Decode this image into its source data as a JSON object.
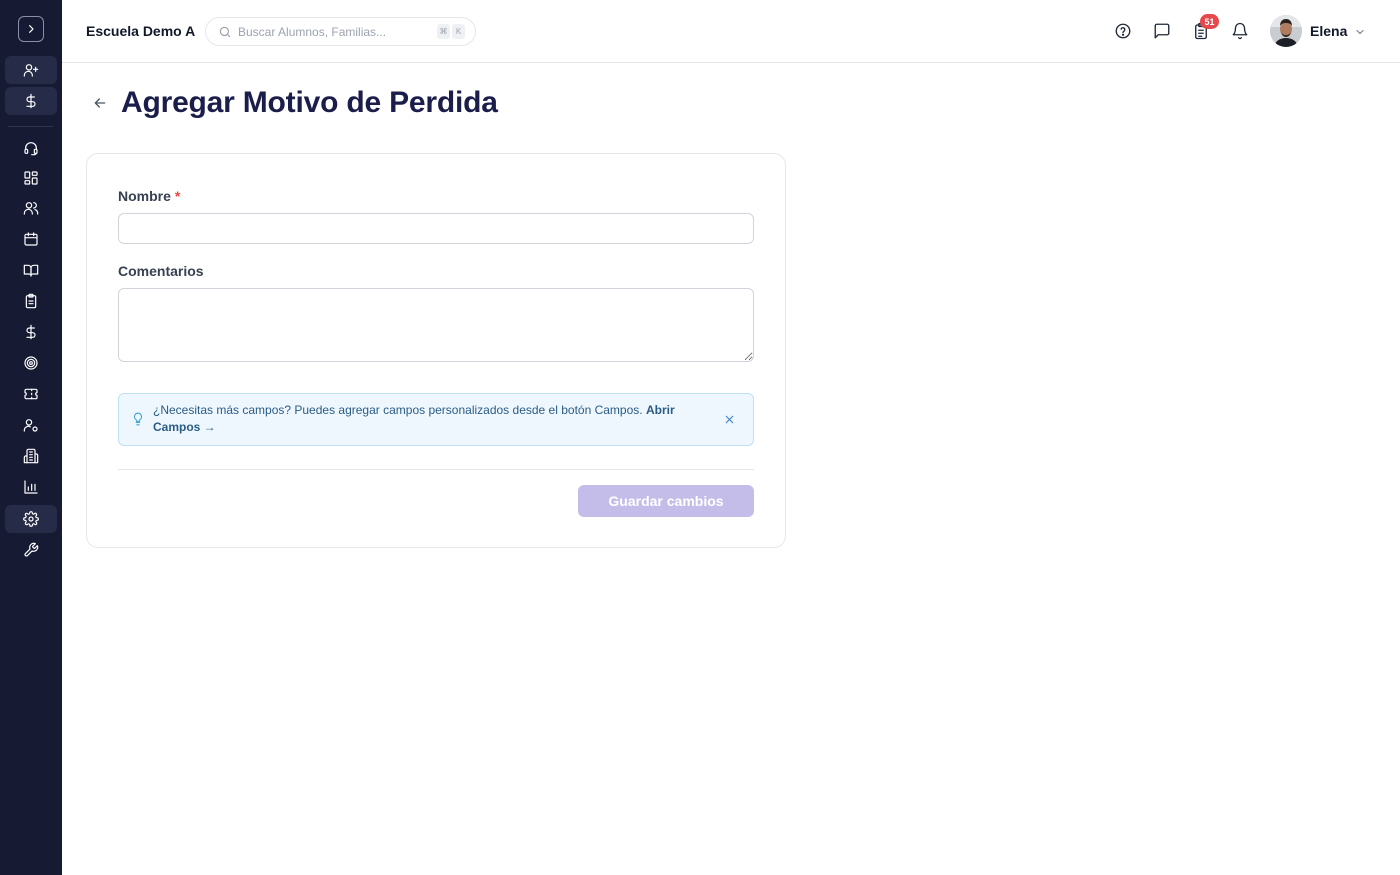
{
  "sidebar": {
    "toggle_icon": "chevron-right-icon",
    "items": [
      {
        "name": "user-plus-icon",
        "highlighted": true
      },
      {
        "name": "dollar-icon",
        "highlighted": true
      },
      {
        "name": "headset-icon",
        "highlighted": false
      },
      {
        "name": "dashboard-grid-icon",
        "highlighted": false
      },
      {
        "name": "users-icon",
        "highlighted": false
      },
      {
        "name": "calendar-icon",
        "highlighted": false
      },
      {
        "name": "book-open-icon",
        "highlighted": false
      },
      {
        "name": "clipboard-icon",
        "highlighted": false
      },
      {
        "name": "dollar-icon",
        "highlighted": false
      },
      {
        "name": "target-icon",
        "highlighted": false
      },
      {
        "name": "ticket-icon",
        "highlighted": false
      },
      {
        "name": "user-settings-icon",
        "highlighted": false
      },
      {
        "name": "building-icon",
        "highlighted": false
      },
      {
        "name": "bar-chart-icon",
        "highlighted": false
      },
      {
        "name": "gear-icon",
        "highlighted": true
      },
      {
        "name": "wrench-icon",
        "highlighted": false
      }
    ]
  },
  "header": {
    "school_name": "Escuela Demo A",
    "search_placeholder": "Buscar Alumnos, Familias...",
    "shortcut_keys": [
      "⌘",
      "K"
    ],
    "notification_count": "51",
    "user_name": "Elena"
  },
  "page": {
    "title": "Agregar Motivo de Perdida"
  },
  "form": {
    "nombre_label": "Nombre",
    "required_mark": "*",
    "nombre_value": "",
    "comentarios_label": "Comentarios",
    "comentarios_value": "",
    "info_text": "¿Necesitas más campos? Puedes agregar campos personalizados desde el botón Campos.",
    "info_link": "Abrir Campos →",
    "save_label": "Guardar cambios"
  },
  "colors": {
    "sidebar_bg": "#161a33",
    "title": "#1b1d4a",
    "save_button": "#c5bde9",
    "info_bg": "#eef7fd",
    "badge": "#e5484d"
  }
}
